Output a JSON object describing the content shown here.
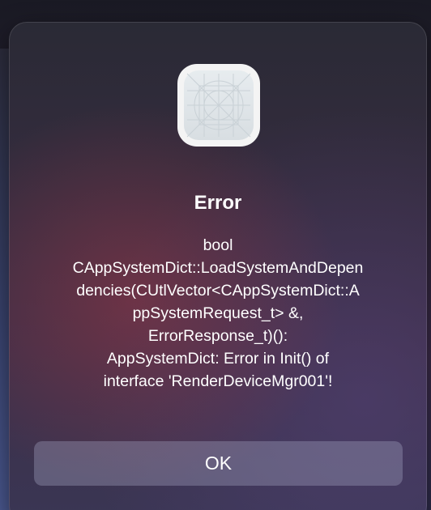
{
  "dialog": {
    "icon": "generic-app-icon",
    "title": "Error",
    "message": "bool\nCAppSystemDict::LoadSystemAndDepen\ndencies(CUtlVector<CAppSystemDict::A\nppSystemRequest_t> &,\nErrorResponse_t)():\nAppSystemDict: Error in Init() of\ninterface 'RenderDeviceMgr001'!",
    "ok_label": "OK"
  }
}
